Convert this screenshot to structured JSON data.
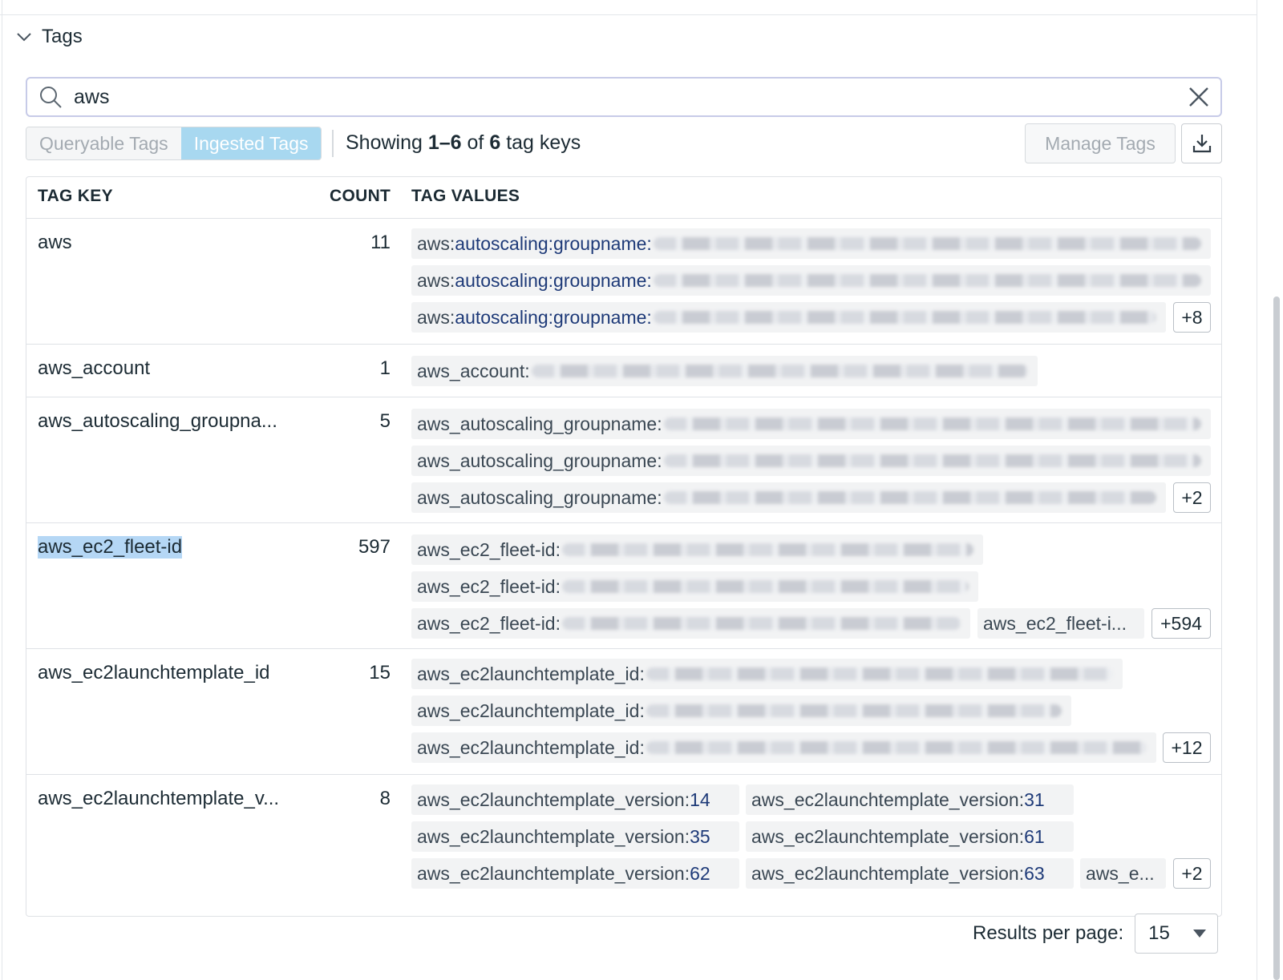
{
  "section": {
    "title": "Tags"
  },
  "search": {
    "value": "aws",
    "placeholder": ""
  },
  "tabs": [
    {
      "label": "Queryable Tags",
      "active": false
    },
    {
      "label": "Ingested Tags",
      "active": true
    }
  ],
  "summary": {
    "prefix": "Showing",
    "range": "1–6",
    "of": "of",
    "total": "6",
    "suffix": "tag keys"
  },
  "actions": {
    "manage_label": "Manage Tags",
    "download_icon": "download-icon"
  },
  "table": {
    "headers": {
      "key": "TAG KEY",
      "count": "COUNT",
      "values": "TAG VALUES"
    },
    "rows": [
      {
        "key": "aws",
        "count": "11",
        "chips": [
          {
            "name": "aws:",
            "value": "autoscaling:groupname:"
          },
          {
            "name": "aws:",
            "value": "autoscaling:groupname:"
          },
          {
            "name": "aws:",
            "value": "autoscaling:groupname:"
          }
        ],
        "more": "+8"
      },
      {
        "key": "aws_account",
        "count": "1",
        "chips": [
          {
            "name": "aws_account:",
            "value": ""
          }
        ],
        "more": ""
      },
      {
        "key": "aws_autoscaling_groupna...",
        "count": "5",
        "chips": [
          {
            "name": "aws_autoscaling_groupname:",
            "value": ""
          },
          {
            "name": "aws_autoscaling_groupname:",
            "value": ""
          },
          {
            "name": "aws_autoscaling_groupname:",
            "value": ""
          }
        ],
        "more": "+2"
      },
      {
        "key": "aws_ec2_fleet-id",
        "count": "597",
        "selected": true,
        "chips": [
          {
            "name": "aws_ec2_fleet-id:",
            "value": ""
          },
          {
            "name": "aws_ec2_fleet-id:",
            "value": ""
          },
          {
            "name": "aws_ec2_fleet-id:",
            "value": ""
          },
          {
            "name": "aws_ec2_fleet-i...",
            "value": ""
          }
        ],
        "more": "+594"
      },
      {
        "key": "aws_ec2launchtemplate_id",
        "count": "15",
        "chips": [
          {
            "name": "aws_ec2launchtemplate_id:",
            "value": ""
          },
          {
            "name": "aws_ec2launchtemplate_id:",
            "value": ""
          },
          {
            "name": "aws_ec2launchtemplate_id:",
            "value": ""
          }
        ],
        "more": "+12"
      },
      {
        "key": "aws_ec2launchtemplate_v...",
        "count": "8",
        "chips": [
          {
            "name": "aws_ec2launchtemplate_version:",
            "value": "14"
          },
          {
            "name": "aws_ec2launchtemplate_version:",
            "value": "31"
          },
          {
            "name": "aws_ec2launchtemplate_version:",
            "value": "35"
          },
          {
            "name": "aws_ec2launchtemplate_version:",
            "value": "61"
          },
          {
            "name": "aws_ec2launchtemplate_version:",
            "value": "62"
          },
          {
            "name": "aws_ec2launchtemplate_version:",
            "value": "63"
          },
          {
            "name": "aws_e...",
            "value": ""
          }
        ],
        "more": "+2"
      }
    ]
  },
  "pagination": {
    "label": "Results per page:",
    "value": "15"
  }
}
